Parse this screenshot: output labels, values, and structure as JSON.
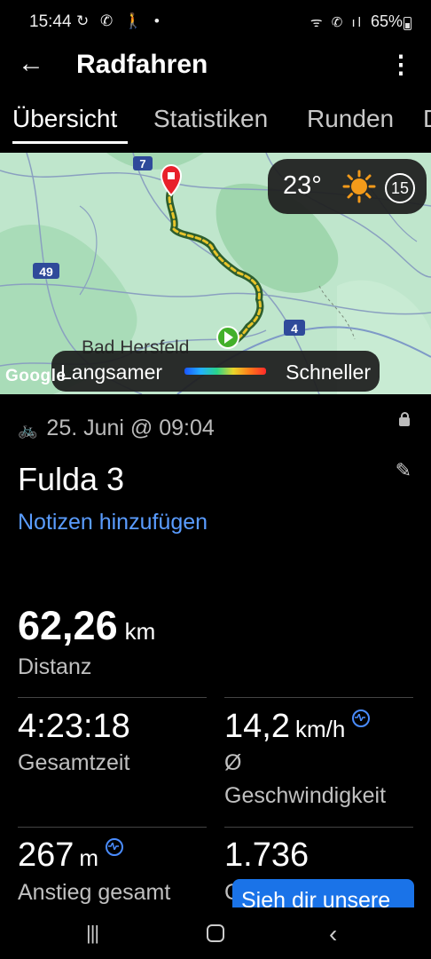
{
  "status": {
    "time": "15:44",
    "left_icons": "↻ ✆ 🚶 •",
    "right_icons": "ᯤ ✆ ıl",
    "battery": "65%"
  },
  "appbar": {
    "back_icon": "arrow-left",
    "title": "Radfahren",
    "more_icon": "more-vert"
  },
  "tabs": [
    {
      "label": "Übersicht",
      "active": true
    },
    {
      "label": "Statistiken"
    },
    {
      "label": "Runden"
    },
    {
      "label": "D"
    }
  ],
  "map": {
    "weather_temp": "23°",
    "wind": "15",
    "legend_slow": "Langsamer",
    "legend_fast": "Schneller",
    "place_label": "Bad Hersfeld",
    "road_7": "7",
    "road_49": "49",
    "road_4": "4",
    "google": "Google"
  },
  "activity": {
    "date": "25. Juni @ 09:04",
    "title": "Fulda 3",
    "notes_link": "Notizen hinzufügen"
  },
  "stats": {
    "distance_value": "62,26",
    "distance_unit": "km",
    "distance_label": "Distanz",
    "time_value": "4:23:18",
    "time_label": "Gesamtzeit",
    "speed_value": "14,2",
    "speed_unit": "km/h",
    "speed_label_1": "Ø",
    "speed_label_2": "Geschwindigkeit",
    "ascent_value": "267",
    "ascent_unit": "m",
    "ascent_label": "Anstieg gesamt",
    "calories_value": "1.736",
    "calories_label_partial": "C"
  },
  "cta": {
    "label": "Sieh dir unsere"
  },
  "colors": {
    "accent_blue": "#5a9cff",
    "cta_blue": "#1a73e8",
    "start_marker": "#43b02a",
    "end_marker": "#e8202a"
  }
}
